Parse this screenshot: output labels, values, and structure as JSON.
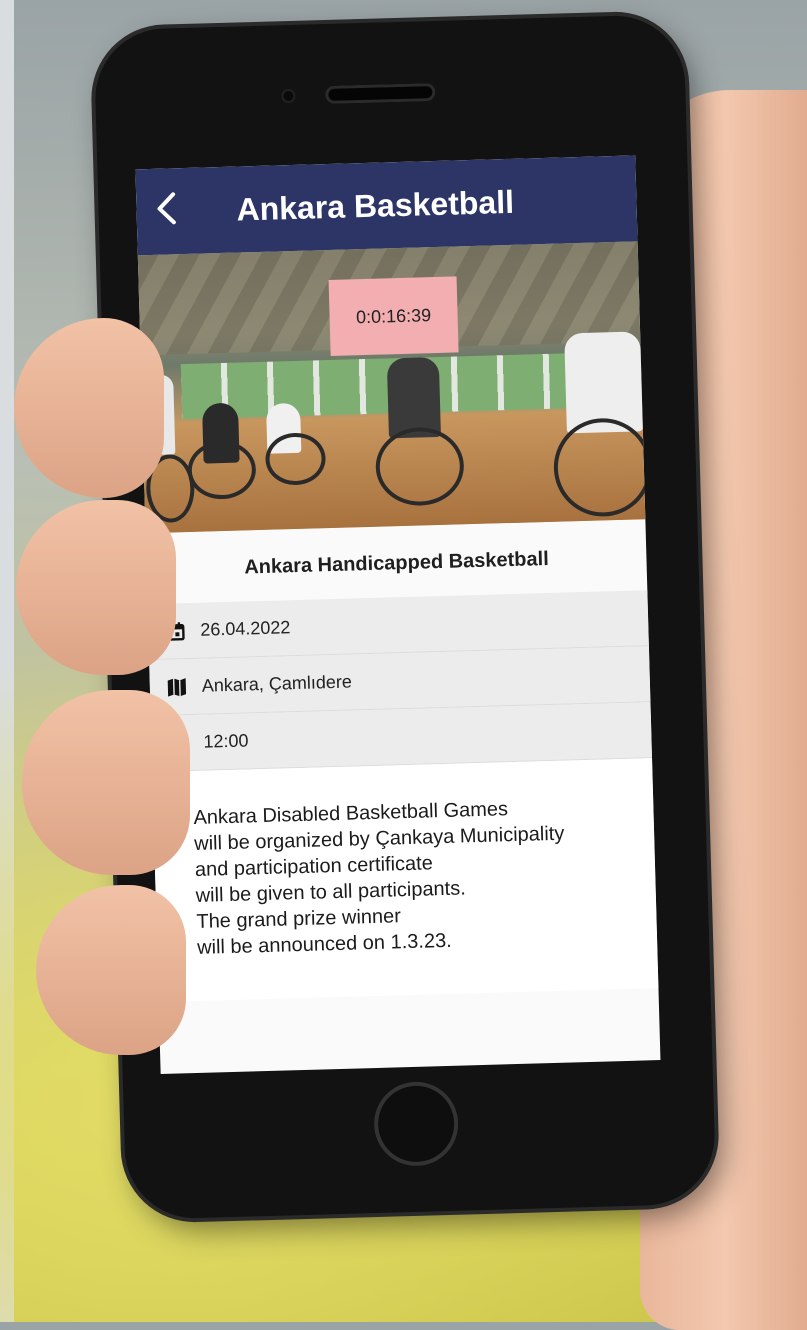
{
  "app_bar": {
    "back_icon": "chevron-left-icon",
    "title": "Ankara Basketball"
  },
  "hero": {
    "timer": "0:0:16:39"
  },
  "event": {
    "name": "Ankara Handicapped Basketball",
    "date": "26.04.2022",
    "date_icon": "calendar-icon",
    "location": "Ankara, Çamlıdere",
    "location_icon": "map-icon",
    "time": "12:00",
    "time_icon": "clock-icon",
    "description_lines": [
      "Ankara Disabled Basketball Games",
      "will be organized by Çankaya Municipality",
      "and participation certificate",
      "will be given to all participants.",
      "The grand prize winner",
      "will be announced on 1.3.23."
    ]
  },
  "colors": {
    "app_bar": "#2d3566",
    "timer_bg": "#f2aeb0"
  }
}
